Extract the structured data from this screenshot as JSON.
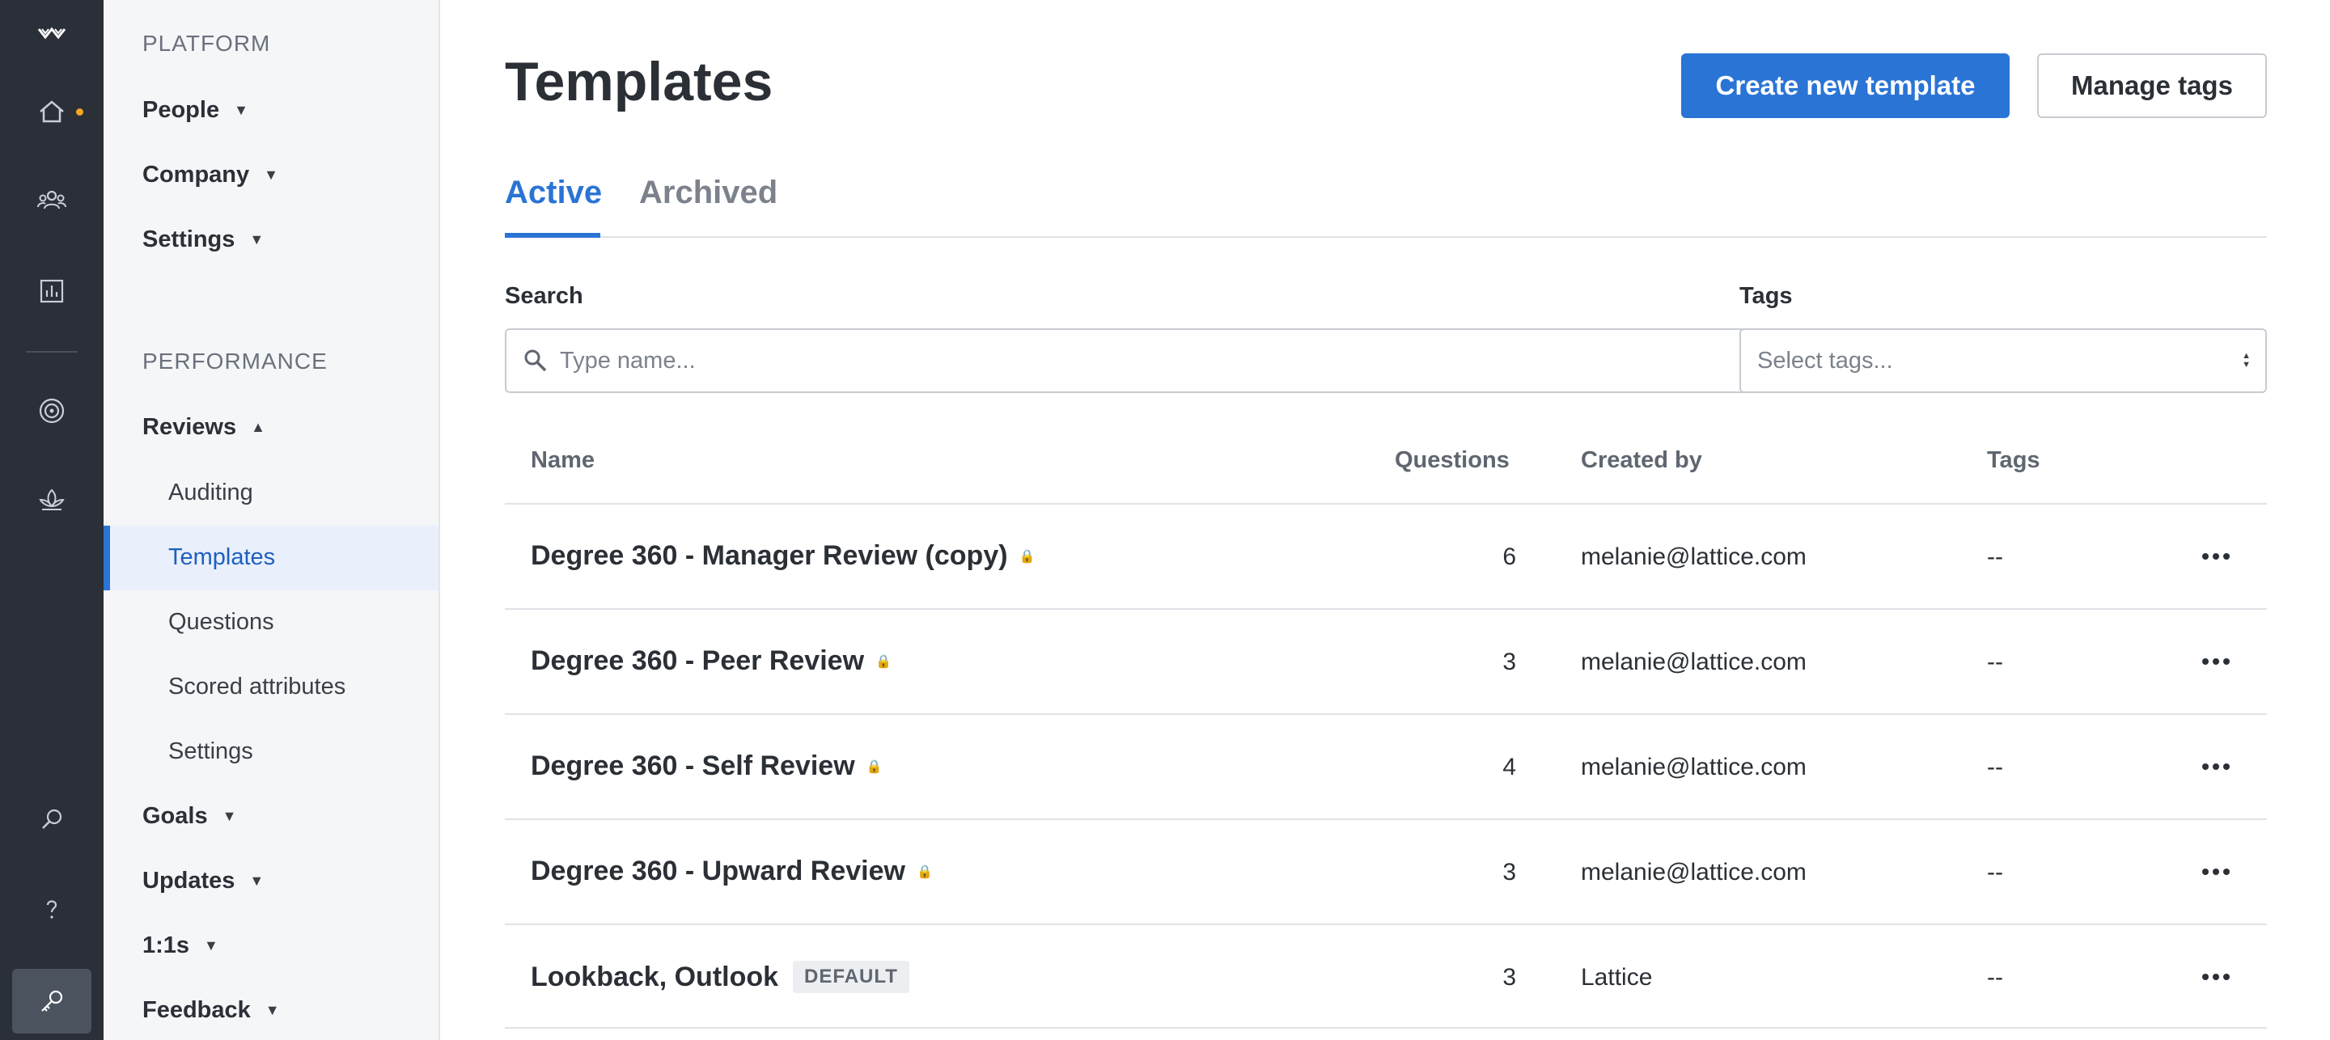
{
  "rail": {
    "icons": [
      "lattice-logo-icon",
      "home-icon",
      "people-icon",
      "reports-icon",
      "goals-target-icon",
      "growth-icon",
      "search-icon",
      "help-icon",
      "admin-key-icon"
    ]
  },
  "sidebar": {
    "platform_label": "PLATFORM",
    "platform_items": [
      "People",
      "Company",
      "Settings"
    ],
    "performance_label": "PERFORMANCE",
    "reviews_label": "Reviews",
    "reviews_sub": [
      "Auditing",
      "Templates",
      "Questions",
      "Scored attributes",
      "Settings"
    ],
    "other_items": [
      "Goals",
      "Updates",
      "1:1s",
      "Feedback"
    ],
    "active_item": "Templates"
  },
  "header": {
    "title": "Templates",
    "create_button": "Create new template",
    "manage_button": "Manage tags"
  },
  "tabs": {
    "active": "Active",
    "archived": "Archived"
  },
  "filters": {
    "search_label": "Search",
    "search_placeholder": "Type name...",
    "tags_label": "Tags",
    "tags_placeholder": "Select tags..."
  },
  "table": {
    "columns": [
      "Name",
      "Questions",
      "Created by",
      "Tags"
    ],
    "rows": [
      {
        "name": "Degree 360 - Manager Review (copy)",
        "locked": true,
        "badge": "",
        "questions": "6",
        "created_by": "melanie@lattice.com",
        "tags": "--"
      },
      {
        "name": "Degree 360 - Peer Review",
        "locked": true,
        "badge": "",
        "questions": "3",
        "created_by": "melanie@lattice.com",
        "tags": "--"
      },
      {
        "name": "Degree 360 - Self Review",
        "locked": true,
        "badge": "",
        "questions": "4",
        "created_by": "melanie@lattice.com",
        "tags": "--"
      },
      {
        "name": "Degree 360 - Upward Review",
        "locked": true,
        "badge": "",
        "questions": "3",
        "created_by": "melanie@lattice.com",
        "tags": "--"
      },
      {
        "name": "Lookback, Outlook",
        "locked": false,
        "badge": "DEFAULT",
        "questions": "3",
        "created_by": "Lattice",
        "tags": "--"
      }
    ]
  },
  "colors": {
    "rail_bg": "#2a2f38",
    "sidebar_bg": "#f5f6f8",
    "accent": "#2a74d6",
    "notification_dot": "#f5a623"
  }
}
